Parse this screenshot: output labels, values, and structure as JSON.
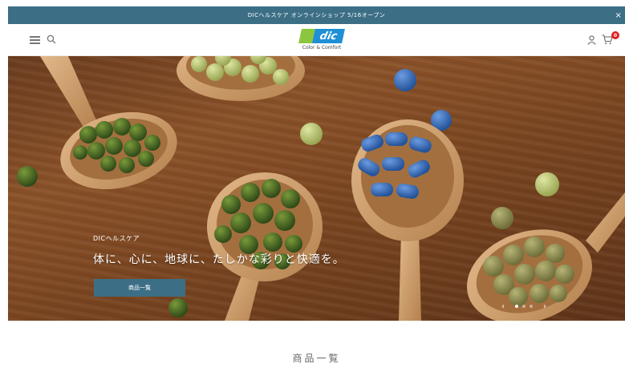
{
  "announcement": {
    "text": "DICヘルスケア オンラインショップ 5/16オープン",
    "close": "×"
  },
  "header": {
    "logo_mark_text": "dic",
    "logo_tagline": "Color & Comfort",
    "cart_count": "0"
  },
  "hero": {
    "eyebrow": "DICヘルスケア",
    "headline": "体に、心に、地球に、たしかな彩りと快適を。",
    "button_label": "商品一覧",
    "prev": "‹",
    "next": "›",
    "slides": 3,
    "active_slide": 1
  },
  "section": {
    "title": "商品一覧"
  },
  "colors": {
    "accent": "#3c6f86",
    "badge": "#e02020",
    "logo_green": "#8cc63f",
    "logo_blue": "#1f8fd6"
  },
  "icons": [
    "menu-icon",
    "search-icon",
    "account-icon",
    "cart-icon"
  ]
}
